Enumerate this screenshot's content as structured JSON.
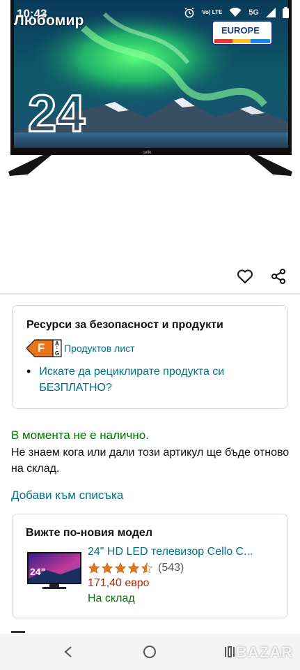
{
  "status_bar": {
    "time": "10:43",
    "seller_name": "Любомир",
    "volte": "Vo) LTE",
    "network": "5G"
  },
  "product_image": {
    "screen_size_label": "24",
    "europe_label": "EUROPE",
    "brand_mark": "cello"
  },
  "actions": {
    "favorite_icon": "heart-icon",
    "share_icon": "share-icon"
  },
  "safety": {
    "title": "Ресурси за безопасност и продукти",
    "energy_class": "F",
    "energy_scale_top": "A",
    "energy_scale_bottom": "G",
    "energy_link": "Продуктов лист",
    "recycle_text": "Искате да рециклирате продукта си БЕЗПЛАТНО?"
  },
  "availability": {
    "status": "В момента не е налично.",
    "note": "Не знаем кога или дали този артикул ще бъде отново на склад.",
    "add_to_list": "Добави към списъка"
  },
  "newer_model": {
    "title": "Вижте по-новия модел",
    "thumb_label": "24\"",
    "name": "24\" HD LED телевизор Cello C...",
    "rating": 4.5,
    "rating_count": "(543)",
    "price": "171,40 евро",
    "stock": "На склад"
  },
  "watermark": "BAZAR",
  "colors": {
    "link": "#007185",
    "in_stock": "#007600",
    "price": "#b12704",
    "energy_f": "#e8751a"
  }
}
